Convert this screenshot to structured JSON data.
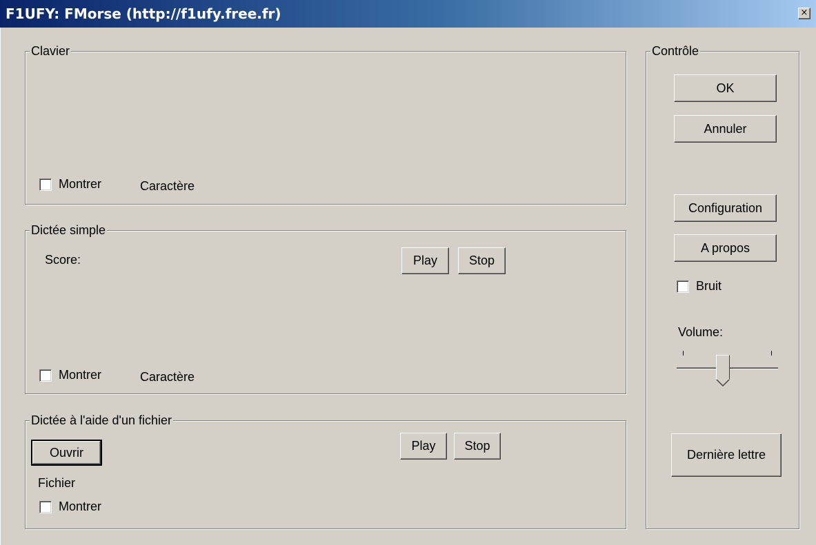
{
  "window": {
    "title": "F1UFY: FMorse (http://f1ufy.free.fr)",
    "close_glyph": "×"
  },
  "clavier": {
    "legend": "Clavier",
    "show_label": "Montrer",
    "char_label": "Caractère"
  },
  "dictee_simple": {
    "legend": "Dictée simple",
    "score_label": "Score:",
    "play_label": "Play",
    "stop_label": "Stop",
    "show_label": "Montrer",
    "char_label": "Caractère"
  },
  "dictee_fichier": {
    "legend": "Dictée à l'aide d'un fichier",
    "open_label": "Ouvrir",
    "play_label": "Play",
    "stop_label": "Stop",
    "file_label": "Fichier",
    "show_label": "Montrer"
  },
  "controle": {
    "legend": "Contrôle",
    "ok_label": "OK",
    "cancel_label": "Annuler",
    "config_label": "Configuration",
    "about_label": "A propos",
    "noise_label": "Bruit",
    "volume_label": "Volume:",
    "volume_level": 0.45,
    "last_letter_label": "Dernière lettre"
  },
  "colors": {
    "face": "#d4d0c8",
    "title_start": "#0a246a",
    "title_end": "#a6caf0"
  }
}
